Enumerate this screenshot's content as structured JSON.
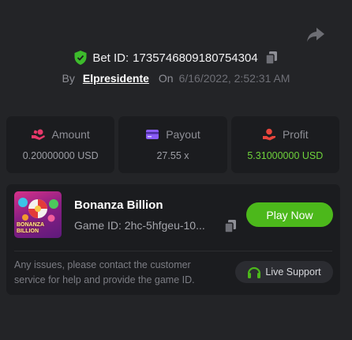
{
  "header": {
    "share_icon": "share-icon",
    "bet_id_prefix": "Bet ID:",
    "bet_id": "1735746809180754304",
    "by_label": "By",
    "username": "Elpresidente",
    "on_label": "On",
    "date": "6/16/2022, 2:52:31 AM"
  },
  "stats": [
    {
      "label": "Amount",
      "value": "0.20000000 USD",
      "icon": "coins-hand-icon"
    },
    {
      "label": "Payout",
      "value": "27.55 x",
      "icon": "card-icon"
    },
    {
      "label": "Profit",
      "value": "5.31000000 USD",
      "icon": "profit-hand-icon"
    }
  ],
  "game": {
    "title": "Bonanza Billion",
    "thumb_text": "BONANZA BILLION",
    "game_id_label": "Game ID:",
    "game_id": "2hc-5hfgeu-10...",
    "play_label": "Play Now"
  },
  "support": {
    "notice": "Any issues, please contact the customer service for help and provide the game ID.",
    "button_label": "Live Support"
  },
  "colors": {
    "background": "#232427",
    "panel": "#1b1c1f",
    "accent_green": "#4cb81b",
    "profit_green": "#6fd33b",
    "amount_icon": "#e6386a",
    "payout_icon": "#8a5cf6",
    "profit_icon": "#e8453c"
  }
}
